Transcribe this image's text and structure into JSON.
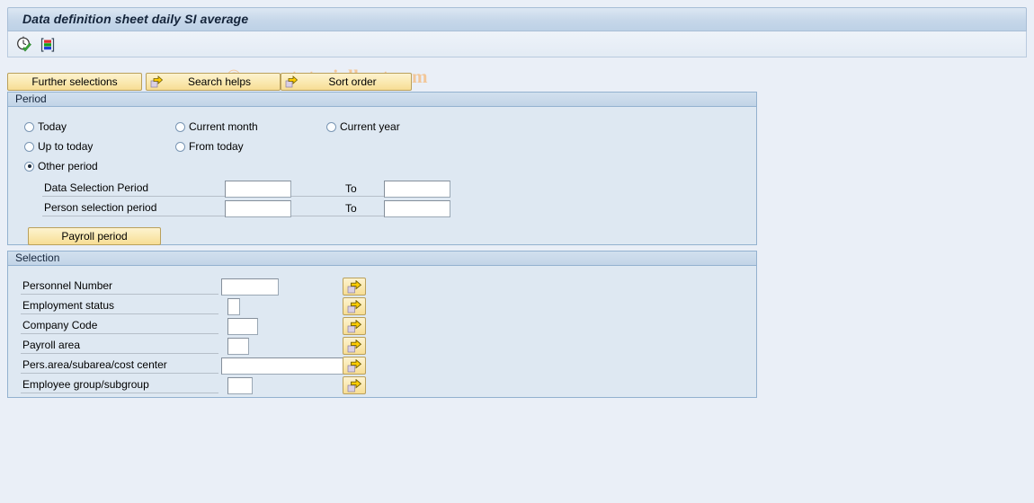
{
  "window": {
    "title": "Data definition sheet daily SI average"
  },
  "watermark": {
    "text": "© www.tutorialkart.com"
  },
  "toolbar": {
    "icons": [
      {
        "name": "execute-icon",
        "tooltip": "Execute"
      },
      {
        "name": "execute-in-background-icon",
        "tooltip": "Execute in Background"
      }
    ]
  },
  "action_buttons": {
    "further_selections": "Further selections",
    "search_helps": "Search helps",
    "sort_order": "Sort order"
  },
  "period": {
    "header": "Period",
    "radios": [
      {
        "label": "Today",
        "checked": false
      },
      {
        "label": "Current month",
        "checked": false
      },
      {
        "label": "Current year",
        "checked": false
      },
      {
        "label": "Up to today",
        "checked": false
      },
      {
        "label": "From today",
        "checked": false
      },
      {
        "label": "Other period",
        "checked": true
      }
    ],
    "fields": [
      {
        "label": "Data Selection Period",
        "value": "",
        "to_label": "To",
        "to_value": ""
      },
      {
        "label": "Person selection period",
        "value": "",
        "to_label": "To",
        "to_value": ""
      }
    ],
    "payroll_period_button": "Payroll period"
  },
  "selection": {
    "header": "Selection",
    "rows": [
      {
        "label": "Personnel Number",
        "value": ""
      },
      {
        "label": "Employment status",
        "value": ""
      },
      {
        "label": "Company Code",
        "value": ""
      },
      {
        "label": "Payroll area",
        "value": ""
      },
      {
        "label": "Pers.area/subarea/cost center",
        "value": ""
      },
      {
        "label": "Employee group/subgroup",
        "value": ""
      }
    ],
    "multi_select_tooltip": "Multiple selection"
  },
  "colors": {
    "window_background": "#eaeff7",
    "panel_background": "#dee8f2",
    "panel_border": "#93b1cf",
    "button_yellow": "#fae9b2",
    "title_text": "#14243a",
    "watermark": "#f2c79a"
  }
}
